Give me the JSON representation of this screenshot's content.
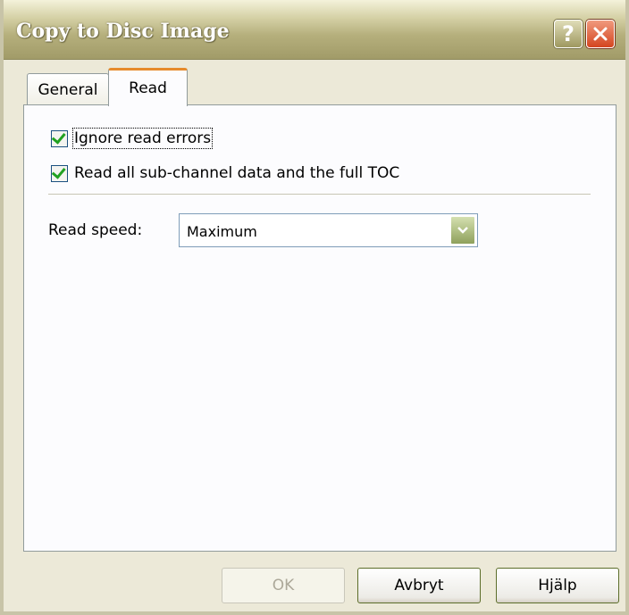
{
  "window": {
    "title": "Copy to Disc Image",
    "help_glyph": "?",
    "colors": {
      "accent_tab": "#E68B2C",
      "check": "#21A121",
      "title_text": "#FFFFFF"
    }
  },
  "tabs": [
    {
      "label": "General",
      "selected": false
    },
    {
      "label": "Read",
      "selected": true
    }
  ],
  "read": {
    "ignore_read_errors": {
      "label": "Ignore read errors",
      "checked": true
    },
    "read_subchannel": {
      "label": "Read all sub-channel data and the full TOC",
      "checked": true
    },
    "read_speed": {
      "label": "Read speed:",
      "value": "Maximum"
    }
  },
  "buttons": {
    "ok": {
      "label": "OK",
      "enabled": false
    },
    "cancel": {
      "label": "Avbryt",
      "enabled": true
    },
    "help": {
      "label": "Hjälp",
      "enabled": true
    }
  }
}
